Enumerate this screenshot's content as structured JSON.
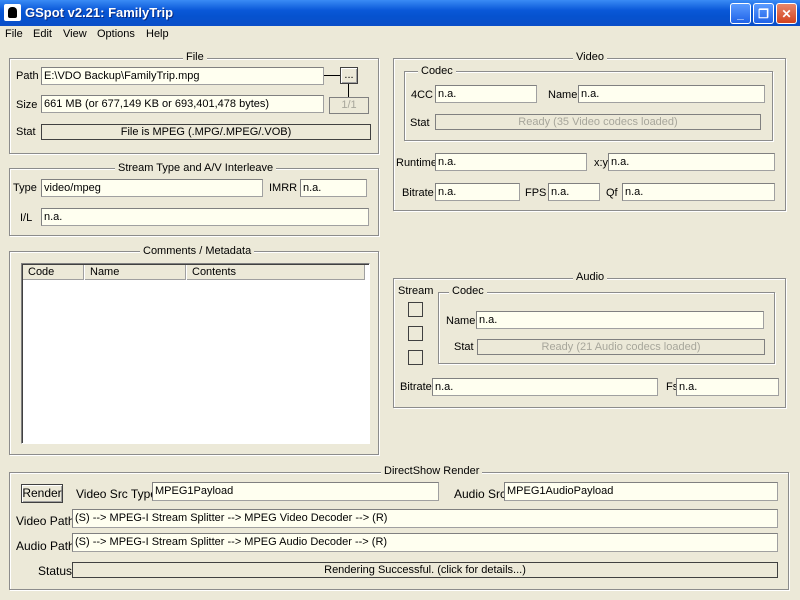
{
  "window": {
    "title": "GSpot v2.21: FamilyTrip",
    "min": "_",
    "max": "❐",
    "close": "✕"
  },
  "menu": [
    "File",
    "Edit",
    "View",
    "Options",
    "Help"
  ],
  "file": {
    "group": "File",
    "path_label": "Path",
    "path": "E:\\VDO Backup\\FamilyTrip.mpg",
    "browse": "...",
    "counter": "1/1",
    "size_label": "Size",
    "size": "661 MB (or 677,149 KB or 693,401,478 bytes)",
    "stat_label": "Stat",
    "stat": "File is MPEG (.MPG/.MPEG/.VOB)"
  },
  "stream": {
    "group": "Stream Type and A/V Interleave",
    "type_label": "Type",
    "type": "video/mpeg",
    "imrr_label": "IMRR",
    "imrr": "n.a.",
    "il_label": "I/L",
    "il": "n.a."
  },
  "comments": {
    "group": "Comments / Metadata",
    "columns": [
      "Code",
      "Name",
      "Contents"
    ]
  },
  "video": {
    "group": "Video",
    "codec_group": "Codec",
    "fourcc_label": "4CC",
    "fourcc": "n.a.",
    "name_label": "Name",
    "name": "n.a.",
    "stat_label": "Stat",
    "stat": "Ready (35 Video codecs loaded)",
    "runtime_label": "Runtime",
    "runtime": "n.a.",
    "xy_label": "x:y",
    "xy": "n.a.",
    "bitrate_label": "Bitrate",
    "bitrate": "n.a.",
    "fps_label": "FPS",
    "fps": "n.a.",
    "qf_label": "Qf",
    "qf": "n.a."
  },
  "audio": {
    "group": "Audio",
    "stream_label": "Stream",
    "codec_group": "Codec",
    "name_label": "Name",
    "name": "n.a.",
    "stat_label": "Stat",
    "stat": "Ready (21 Audio codecs loaded)",
    "bitrate_label": "Bitrate",
    "bitrate": "n.a.",
    "fs_label": "Fs",
    "fs": "n.a."
  },
  "render": {
    "group": "DirectShow Render",
    "button": "Render",
    "video_src_label": "Video Src Type",
    "video_src": "MPEG1Payload",
    "audio_src_label": "Audio Src",
    "audio_src": "MPEG1AudioPayload",
    "video_path_label": "Video Path",
    "video_path": "(S) --> MPEG-I Stream Splitter --> MPEG Video Decoder --> (R)",
    "audio_path_label": "Audio Path",
    "audio_path": "(S) --> MPEG-I Stream Splitter --> MPEG Audio Decoder --> (R)",
    "status_label": "Status",
    "status": "Rendering Successful.  (click for details...)"
  }
}
